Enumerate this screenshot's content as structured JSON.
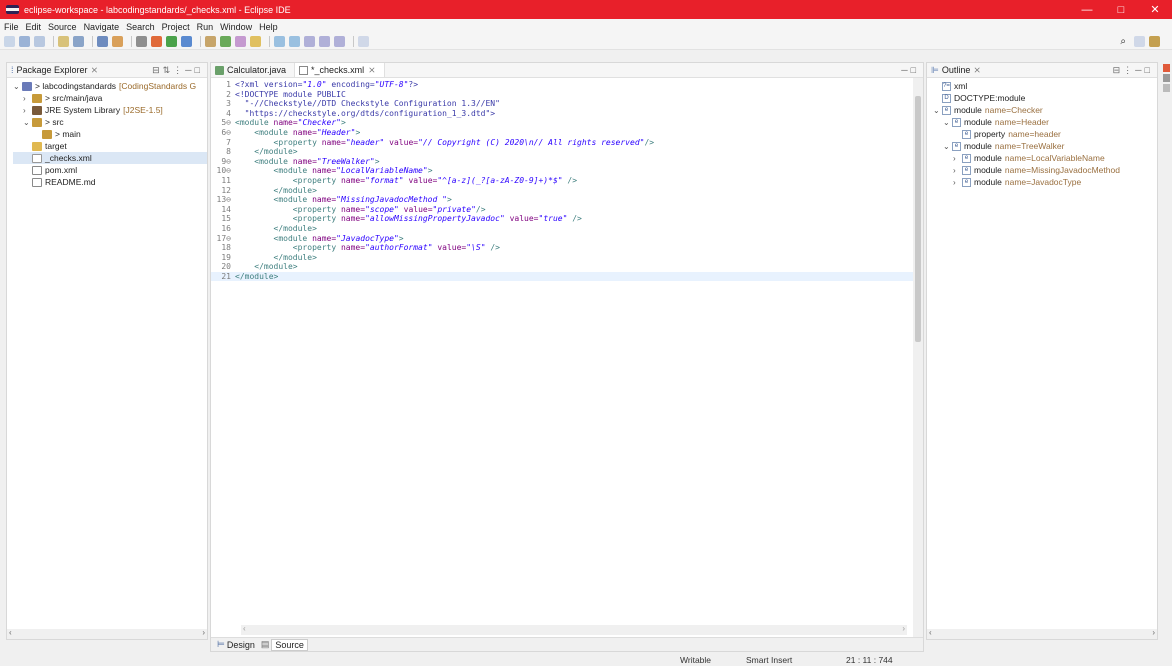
{
  "window": {
    "title": "eclipse-workspace - labcodingstandards/_checks.xml - Eclipse IDE",
    "min": "—",
    "max": "□",
    "close": "✕"
  },
  "menu": [
    "File",
    "Edit",
    "Source",
    "Navigate",
    "Search",
    "Project",
    "Run",
    "Window",
    "Help"
  ],
  "package_explorer": {
    "title": "Package Explorer",
    "items": [
      {
        "indent": 0,
        "twisty": "⌄",
        "icon": "proj",
        "label": "> labcodingstandards",
        "decoration": "[CodingStandards G"
      },
      {
        "indent": 1,
        "twisty": "›",
        "icon": "pkg",
        "label": "> src/main/java",
        "decoration": ""
      },
      {
        "indent": 1,
        "twisty": "›",
        "icon": "lib",
        "label": "JRE System Library",
        "decoration": "[J2SE-1.5]"
      },
      {
        "indent": 1,
        "twisty": "⌄",
        "icon": "pkg",
        "label": "> src",
        "decoration": ""
      },
      {
        "indent": 2,
        "twisty": "",
        "icon": "pkg",
        "label": "> main",
        "decoration": ""
      },
      {
        "indent": 1,
        "twisty": "",
        "icon": "folder",
        "label": "target",
        "decoration": ""
      },
      {
        "indent": 1,
        "twisty": "",
        "icon": "xml",
        "label": "_checks.xml",
        "decoration": ""
      },
      {
        "indent": 1,
        "twisty": "",
        "icon": "file",
        "label": "pom.xml",
        "decoration": ""
      },
      {
        "indent": 1,
        "twisty": "",
        "icon": "file",
        "label": "README.md",
        "decoration": ""
      }
    ]
  },
  "editor": {
    "tabs": [
      {
        "label": "Calculator.java",
        "active": false
      },
      {
        "label": "*_checks.xml",
        "active": true
      }
    ],
    "lines": [
      {
        "n": "1",
        "html": "<span class='ct'>&lt;?xml version=<span class='val'>\"1.0\"</span> encoding=<span class='val'>\"UTF-8\"</span>?&gt;</span>"
      },
      {
        "n": "2",
        "html": "<span class='ct'>&lt;!DOCTYPE module PUBLIC</span>"
      },
      {
        "n": "3",
        "html": "<span class='ct'>  \"-//Checkstyle//DTD Checkstyle Configuration 1.3//EN\"</span>"
      },
      {
        "n": "4",
        "html": "<span class='ct'>  \"https://checkstyle.org/dtds/configuration_1_3.dtd\"&gt;</span>"
      },
      {
        "n": "5⊖",
        "html": "<span class='tag'>&lt;module</span> <span class='attr'>name=</span><span class='val'>\"Checker\"</span><span class='tag'>&gt;</span>"
      },
      {
        "n": "6⊖",
        "html": "    <span class='tag'>&lt;module</span> <span class='attr'>name=</span><span class='val'>\"Header\"</span><span class='tag'>&gt;</span>"
      },
      {
        "n": "7",
        "html": "        <span class='tag'>&lt;property</span> <span class='attr'>name=</span><span class='val'>\"header\"</span> <span class='attr'>value=</span><span class='val'>\"// Copyright (C) 2020\\n// All rights reserved\"</span><span class='tag'>/&gt;</span>"
      },
      {
        "n": "8",
        "html": "    <span class='tag'>&lt;/module&gt;</span>"
      },
      {
        "n": "9⊖",
        "html": "    <span class='tag'>&lt;module</span> <span class='attr'>name=</span><span class='val'>\"TreeWalker\"</span><span class='tag'>&gt;</span>"
      },
      {
        "n": "10⊖",
        "html": "        <span class='tag'>&lt;module</span> <span class='attr'>name=</span><span class='val'>\"LocalVariableName\"</span><span class='tag'>&gt;</span>"
      },
      {
        "n": "11",
        "html": "            <span class='tag'>&lt;property</span> <span class='attr'>name=</span><span class='val'>\"format\"</span> <span class='attr'>value=</span><span class='val'>\"^[a-z](_?[a-zA-Z0-9]+)*$\"</span> <span class='tag'>/&gt;</span>"
      },
      {
        "n": "12",
        "html": "        <span class='tag'>&lt;/module&gt;</span>"
      },
      {
        "n": "13⊖",
        "html": "        <span class='tag'>&lt;module</span> <span class='attr'>name=</span><span class='val'>\"MissingJavadocMethod \"</span><span class='tag'>&gt;</span>"
      },
      {
        "n": "14",
        "html": "            <span class='tag'>&lt;property</span> <span class='attr'>name=</span><span class='val'>\"scope\"</span> <span class='attr'>value=</span><span class='val'>\"private\"</span><span class='tag'>/&gt;</span>"
      },
      {
        "n": "15",
        "html": "            <span class='tag'>&lt;property</span> <span class='attr'>name=</span><span class='val'>\"allowMissingPropertyJavadoc\"</span> <span class='attr'>value=</span><span class='val'>\"true\"</span> <span class='tag'>/&gt;</span>"
      },
      {
        "n": "16",
        "html": "        <span class='tag'>&lt;/module&gt;</span>"
      },
      {
        "n": "17⊖",
        "html": "        <span class='tag'>&lt;module</span> <span class='attr'>name=</span><span class='val'>\"JavadocType\"</span><span class='tag'>&gt;</span>"
      },
      {
        "n": "18",
        "html": "            <span class='tag'>&lt;property</span> <span class='attr'>name=</span><span class='val'>\"authorFormat\"</span> <span class='attr'>value=</span><span class='val'>\"\\S\"</span> <span class='tag'>/&gt;</span>"
      },
      {
        "n": "19",
        "html": "        <span class='tag'>&lt;/module&gt;</span>"
      },
      {
        "n": "20",
        "html": "    <span class='tag'>&lt;/module&gt;</span>"
      },
      {
        "n": "21",
        "html": "<span class='tag'>&lt;/module&gt;</span>"
      }
    ],
    "bottom_tabs": {
      "design": "Design",
      "source": "Source"
    }
  },
  "outline": {
    "title": "Outline",
    "items": [
      {
        "indent": 0,
        "twisty": "",
        "icon": "?=",
        "key": "xml",
        "name": ""
      },
      {
        "indent": 0,
        "twisty": "",
        "icon": "D",
        "key": "DOCTYPE:module",
        "name": ""
      },
      {
        "indent": 0,
        "twisty": "⌄",
        "icon": "e",
        "key": "module",
        "name": "name=Checker"
      },
      {
        "indent": 1,
        "twisty": "⌄",
        "icon": "e",
        "key": "module",
        "name": "name=Header"
      },
      {
        "indent": 2,
        "twisty": "",
        "icon": "e",
        "key": "property",
        "name": "name=header"
      },
      {
        "indent": 1,
        "twisty": "⌄",
        "icon": "e",
        "key": "module",
        "name": "name=TreeWalker"
      },
      {
        "indent": 2,
        "twisty": "›",
        "icon": "e",
        "key": "module",
        "name": "name=LocalVariableName"
      },
      {
        "indent": 2,
        "twisty": "›",
        "icon": "e",
        "key": "module",
        "name": "name=MissingJavadocMethod"
      },
      {
        "indent": 2,
        "twisty": "›",
        "icon": "e",
        "key": "module",
        "name": "name=JavadocType"
      }
    ]
  },
  "status": {
    "writable": "Writable",
    "insert": "Smart Insert",
    "position": "21 : 11 : 744"
  }
}
